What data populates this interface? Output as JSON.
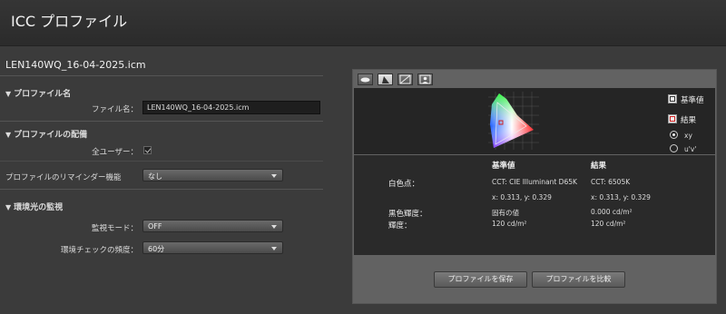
{
  "window": {
    "title": "ICC プロファイル"
  },
  "profile": {
    "filename": "LEN140WQ_16-04-2025.icm",
    "section_name": {
      "title": "プロファイル名",
      "field_label": "ファイル名：",
      "field_value": "LEN140WQ_16-04-2025.icm"
    },
    "section_distribution": {
      "title": "プロファイルの配備",
      "all_users_label": "全ユーザー：",
      "all_users_checked": true,
      "reminder_label": "プロファイルのリマインダー機能",
      "reminder_value": "なし"
    },
    "section_ambient": {
      "title": "環境光の監視",
      "monitor_mode_label": "監視モード：",
      "monitor_mode_value": "OFF",
      "check_freq_label": "環境チェックの頻度：",
      "check_freq_value": "60分"
    }
  },
  "viewer": {
    "legend": {
      "reference": "基準値",
      "result": "結果"
    },
    "colorspace_options": [
      {
        "label": "xy",
        "selected": true
      },
      {
        "label": "u'v'",
        "selected": false
      }
    ],
    "table": {
      "col_reference": "基準値",
      "col_result": "結果",
      "rows": [
        {
          "label": "白色点：",
          "ref": "CCT: CIE Illuminant D65K",
          "res": "CCT: 6505K"
        },
        {
          "label": "",
          "ref": "x: 0.313, y: 0.329",
          "res": "x: 0.313, y: 0.329"
        },
        {
          "label": "黒色輝度：",
          "ref": "固有の値",
          "res": "0.000 cd/m²"
        },
        {
          "label": "輝度：",
          "ref": "120 cd/m²",
          "res": "120 cd/m²"
        }
      ]
    },
    "buttons": {
      "save": "プロファイルを保存",
      "compare": "プロファイルを比較"
    }
  }
}
